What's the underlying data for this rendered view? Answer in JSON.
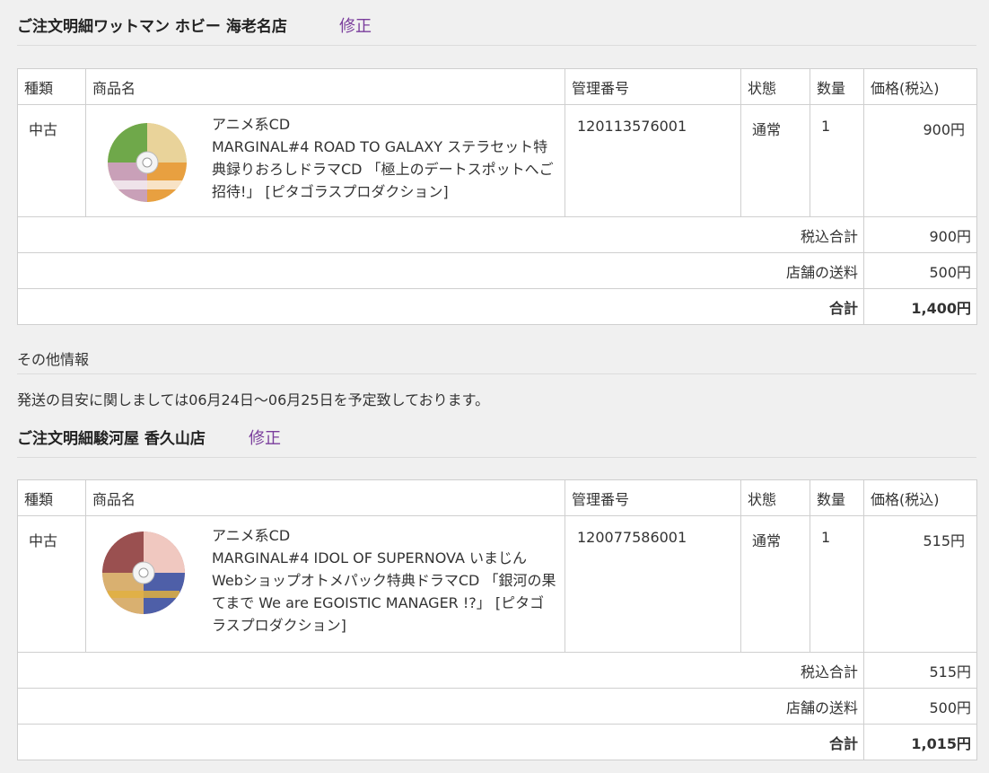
{
  "orders": [
    {
      "title": "ご注文明細ワットマン ホビー 海老名店",
      "edit_label": "修正",
      "columns": [
        "種類",
        "商品名",
        "管理番号",
        "状態",
        "数量",
        "価格(税込)"
      ],
      "item": {
        "kind": "中古",
        "category": "アニメ系CD",
        "name": "MARGINAL#4 ROAD TO GALAXY ステラセット特典録りおろしドラマCD 「極上のデートスポットへご招待!」 [ピタゴラスプロダクション]",
        "management_no": "120113576001",
        "condition": "通常",
        "quantity": "1",
        "price": "900円",
        "image_icon": "cd-disc-image"
      },
      "subtotal_label": "税込合計",
      "subtotal": "900円",
      "shipping_label": "店舗の送料",
      "shipping": "500円",
      "total_label": "合計",
      "total": "1,400円"
    },
    {
      "title": "ご注文明細駿河屋 香久山店",
      "edit_label": "修正",
      "columns": [
        "種類",
        "商品名",
        "管理番号",
        "状態",
        "数量",
        "価格(税込)"
      ],
      "item": {
        "kind": "中古",
        "category": "アニメ系CD",
        "name": "MARGINAL#4 IDOL OF SUPERNOVA いまじんWebショップオトメパック特典ドラマCD 「銀河の果てまで We are EGOISTIC MANAGER !?」 [ピタゴラスプロダクション]",
        "management_no": "120077586001",
        "condition": "通常",
        "quantity": "1",
        "price": "515円",
        "image_icon": "cd-disc-image"
      },
      "subtotal_label": "税込合計",
      "subtotal": "515円",
      "shipping_label": "店舗の送料",
      "shipping": "500円",
      "total_label": "合計",
      "total": "1,015円"
    }
  ],
  "other_info": {
    "title": "その他情報",
    "note": "発送の目安に関しましては06月24日～06月25日を予定致しております。"
  },
  "colors": {
    "link": "#7a3d9c",
    "background": "#f0f0f0",
    "border": "#cfcfcf"
  }
}
